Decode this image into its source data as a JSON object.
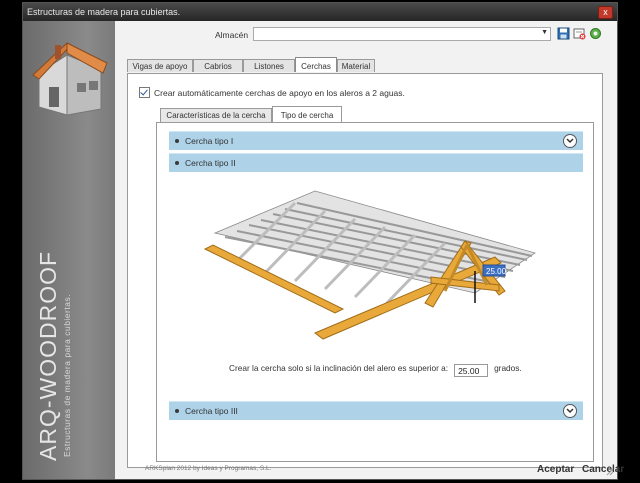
{
  "window": {
    "title": "Estructuras de madera para cubiertas.",
    "close_label": "x"
  },
  "sidebar": {
    "brand_title": "ARQ-WOODROOF",
    "brand_subtitle": "Estructuras de madera para cubiertas."
  },
  "toolbar": {
    "almacen_label": "Almacén",
    "almacen_value": ""
  },
  "tabs": [
    {
      "label": "Vigas de apoyo"
    },
    {
      "label": "Cabrios"
    },
    {
      "label": "Listones"
    },
    {
      "label": "Cerchas"
    },
    {
      "label": "Material"
    }
  ],
  "cerchas_panel": {
    "auto_checkbox_label": "Crear automáticamente cerchas de apoyo en los aleros a 2 aguas.",
    "auto_checked": true,
    "subtabs": [
      {
        "label": "Características de la cercha"
      },
      {
        "label": "Tipo de cercha"
      }
    ],
    "sections": [
      {
        "label": "Cercha tipo I"
      },
      {
        "label": "Cercha tipo II"
      },
      {
        "label": "Cercha tipo III"
      }
    ],
    "dimension_label": "25.00",
    "inclination_prefix": "Crear la cercha solo si la inclinación del alero es superior a:",
    "inclination_value": "25.00",
    "inclination_unit": "grados."
  },
  "footer": {
    "copyright": "ARKSplan 2012 by Ideas y Programas, S.L.",
    "accept_label": "Aceptar",
    "cancel_label": "Cancelar"
  },
  "colors": {
    "section_blue": "#aed3e9",
    "wood": "#e8a93a",
    "close_red": "#c0392b"
  }
}
